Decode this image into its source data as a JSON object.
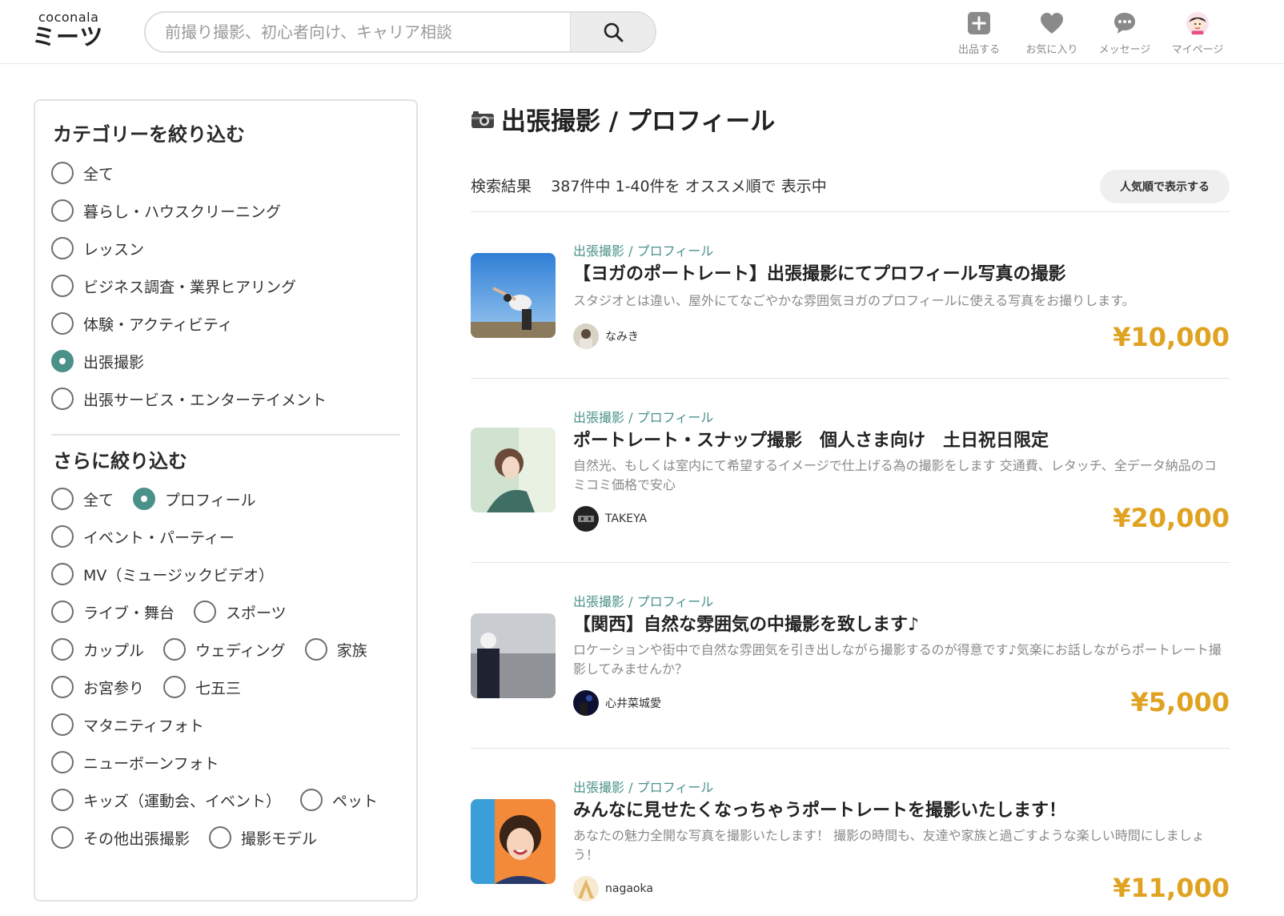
{
  "header": {
    "logo_top": "coconala",
    "logo_main": "ミーツ",
    "search_placeholder": "前撮り撮影、初心者向け、キャリア相談",
    "nav": [
      {
        "label": "出品する",
        "icon": "plus-square-icon"
      },
      {
        "label": "お気に入り",
        "icon": "heart-icon"
      },
      {
        "label": "メッセージ",
        "icon": "chat-bubble-icon"
      },
      {
        "label": "マイページ",
        "icon": "user-avatar-icon"
      }
    ]
  },
  "sidebar": {
    "category_heading": "カテゴリーを絞り込む",
    "categories": [
      {
        "label": "全て",
        "selected": false
      },
      {
        "label": "暮らし・ハウスクリーニング",
        "selected": false
      },
      {
        "label": "レッスン",
        "selected": false
      },
      {
        "label": "ビジネス調査・業界ヒアリング",
        "selected": false
      },
      {
        "label": "体験・アクティビティ",
        "selected": false
      },
      {
        "label": "出張撮影",
        "selected": true
      },
      {
        "label": "出張サービス・エンターテイメント",
        "selected": false
      }
    ],
    "refine_heading": "さらに絞り込む",
    "refine": [
      {
        "label": "全て",
        "selected": false
      },
      {
        "label": "プロフィール",
        "selected": true
      },
      {
        "label": "イベント・パーティー",
        "selected": false
      },
      {
        "label": "MV（ミュージックビデオ）",
        "selected": false
      },
      {
        "label": "ライブ・舞台",
        "selected": false
      },
      {
        "label": "スポーツ",
        "selected": false
      },
      {
        "label": "カップル",
        "selected": false
      },
      {
        "label": "ウェディング",
        "selected": false
      },
      {
        "label": "家族",
        "selected": false
      },
      {
        "label": "お宮参り",
        "selected": false
      },
      {
        "label": "七五三",
        "selected": false
      },
      {
        "label": "マタニティフォト",
        "selected": false
      },
      {
        "label": "ニューボーンフォト",
        "selected": false
      },
      {
        "label": "キッズ（運動会、イベント）",
        "selected": false
      },
      {
        "label": "ペット",
        "selected": false
      },
      {
        "label": "その他出張撮影",
        "selected": false
      },
      {
        "label": "撮影モデル",
        "selected": false
      }
    ]
  },
  "main": {
    "title": "出張撮影 / プロフィール",
    "result_label": "検索結果",
    "result_text": "387件中  1-40件を オススメ順で 表示中",
    "sort_button": "人気順で表示する",
    "listings": [
      {
        "category": "出張撮影 / プロフィール",
        "title": "【ヨガのポートレート】出張撮影にてプロフィール写真の撮影",
        "description": "スタジオとは違い、屋外にてなごやかな雰囲気ヨガのプロフィールに使える写真をお撮りします。",
        "seller": "なみき",
        "price": "¥10,000"
      },
      {
        "category": "出張撮影 / プロフィール",
        "title": "ポートレート・スナップ撮影　個人さま向け　土日祝日限定",
        "description": "自然光、もしくは室内にて希望するイメージで仕上げる為の撮影をします 交通費、レタッチ、全データ納品のコミコミ価格で安心",
        "seller": "TAKEYA",
        "price": "¥20,000"
      },
      {
        "category": "出張撮影 / プロフィール",
        "title": "【関西】自然な雰囲気の中撮影を致します♪",
        "description": "ロケーションや街中で自然な雰囲気を引き出しながら撮影するのが得意です♪気楽にお話しながらポートレート撮影してみませんか？",
        "seller": "心井菜城愛",
        "price": "¥5,000"
      },
      {
        "category": "出張撮影 / プロフィール",
        "title": "みんなに見せたくなっちゃうポートレートを撮影いたします！",
        "description": "あなたの魅力全開な写真を撮影いたします！ 撮影の時間も、友達や家族と過ごすような楽しい時間にしましょう！",
        "seller": "nagaoka",
        "price": "¥11,000"
      }
    ]
  },
  "colors": {
    "accent": "#4a9289",
    "price": "#e0a321",
    "muted": "#8a8a8a"
  }
}
